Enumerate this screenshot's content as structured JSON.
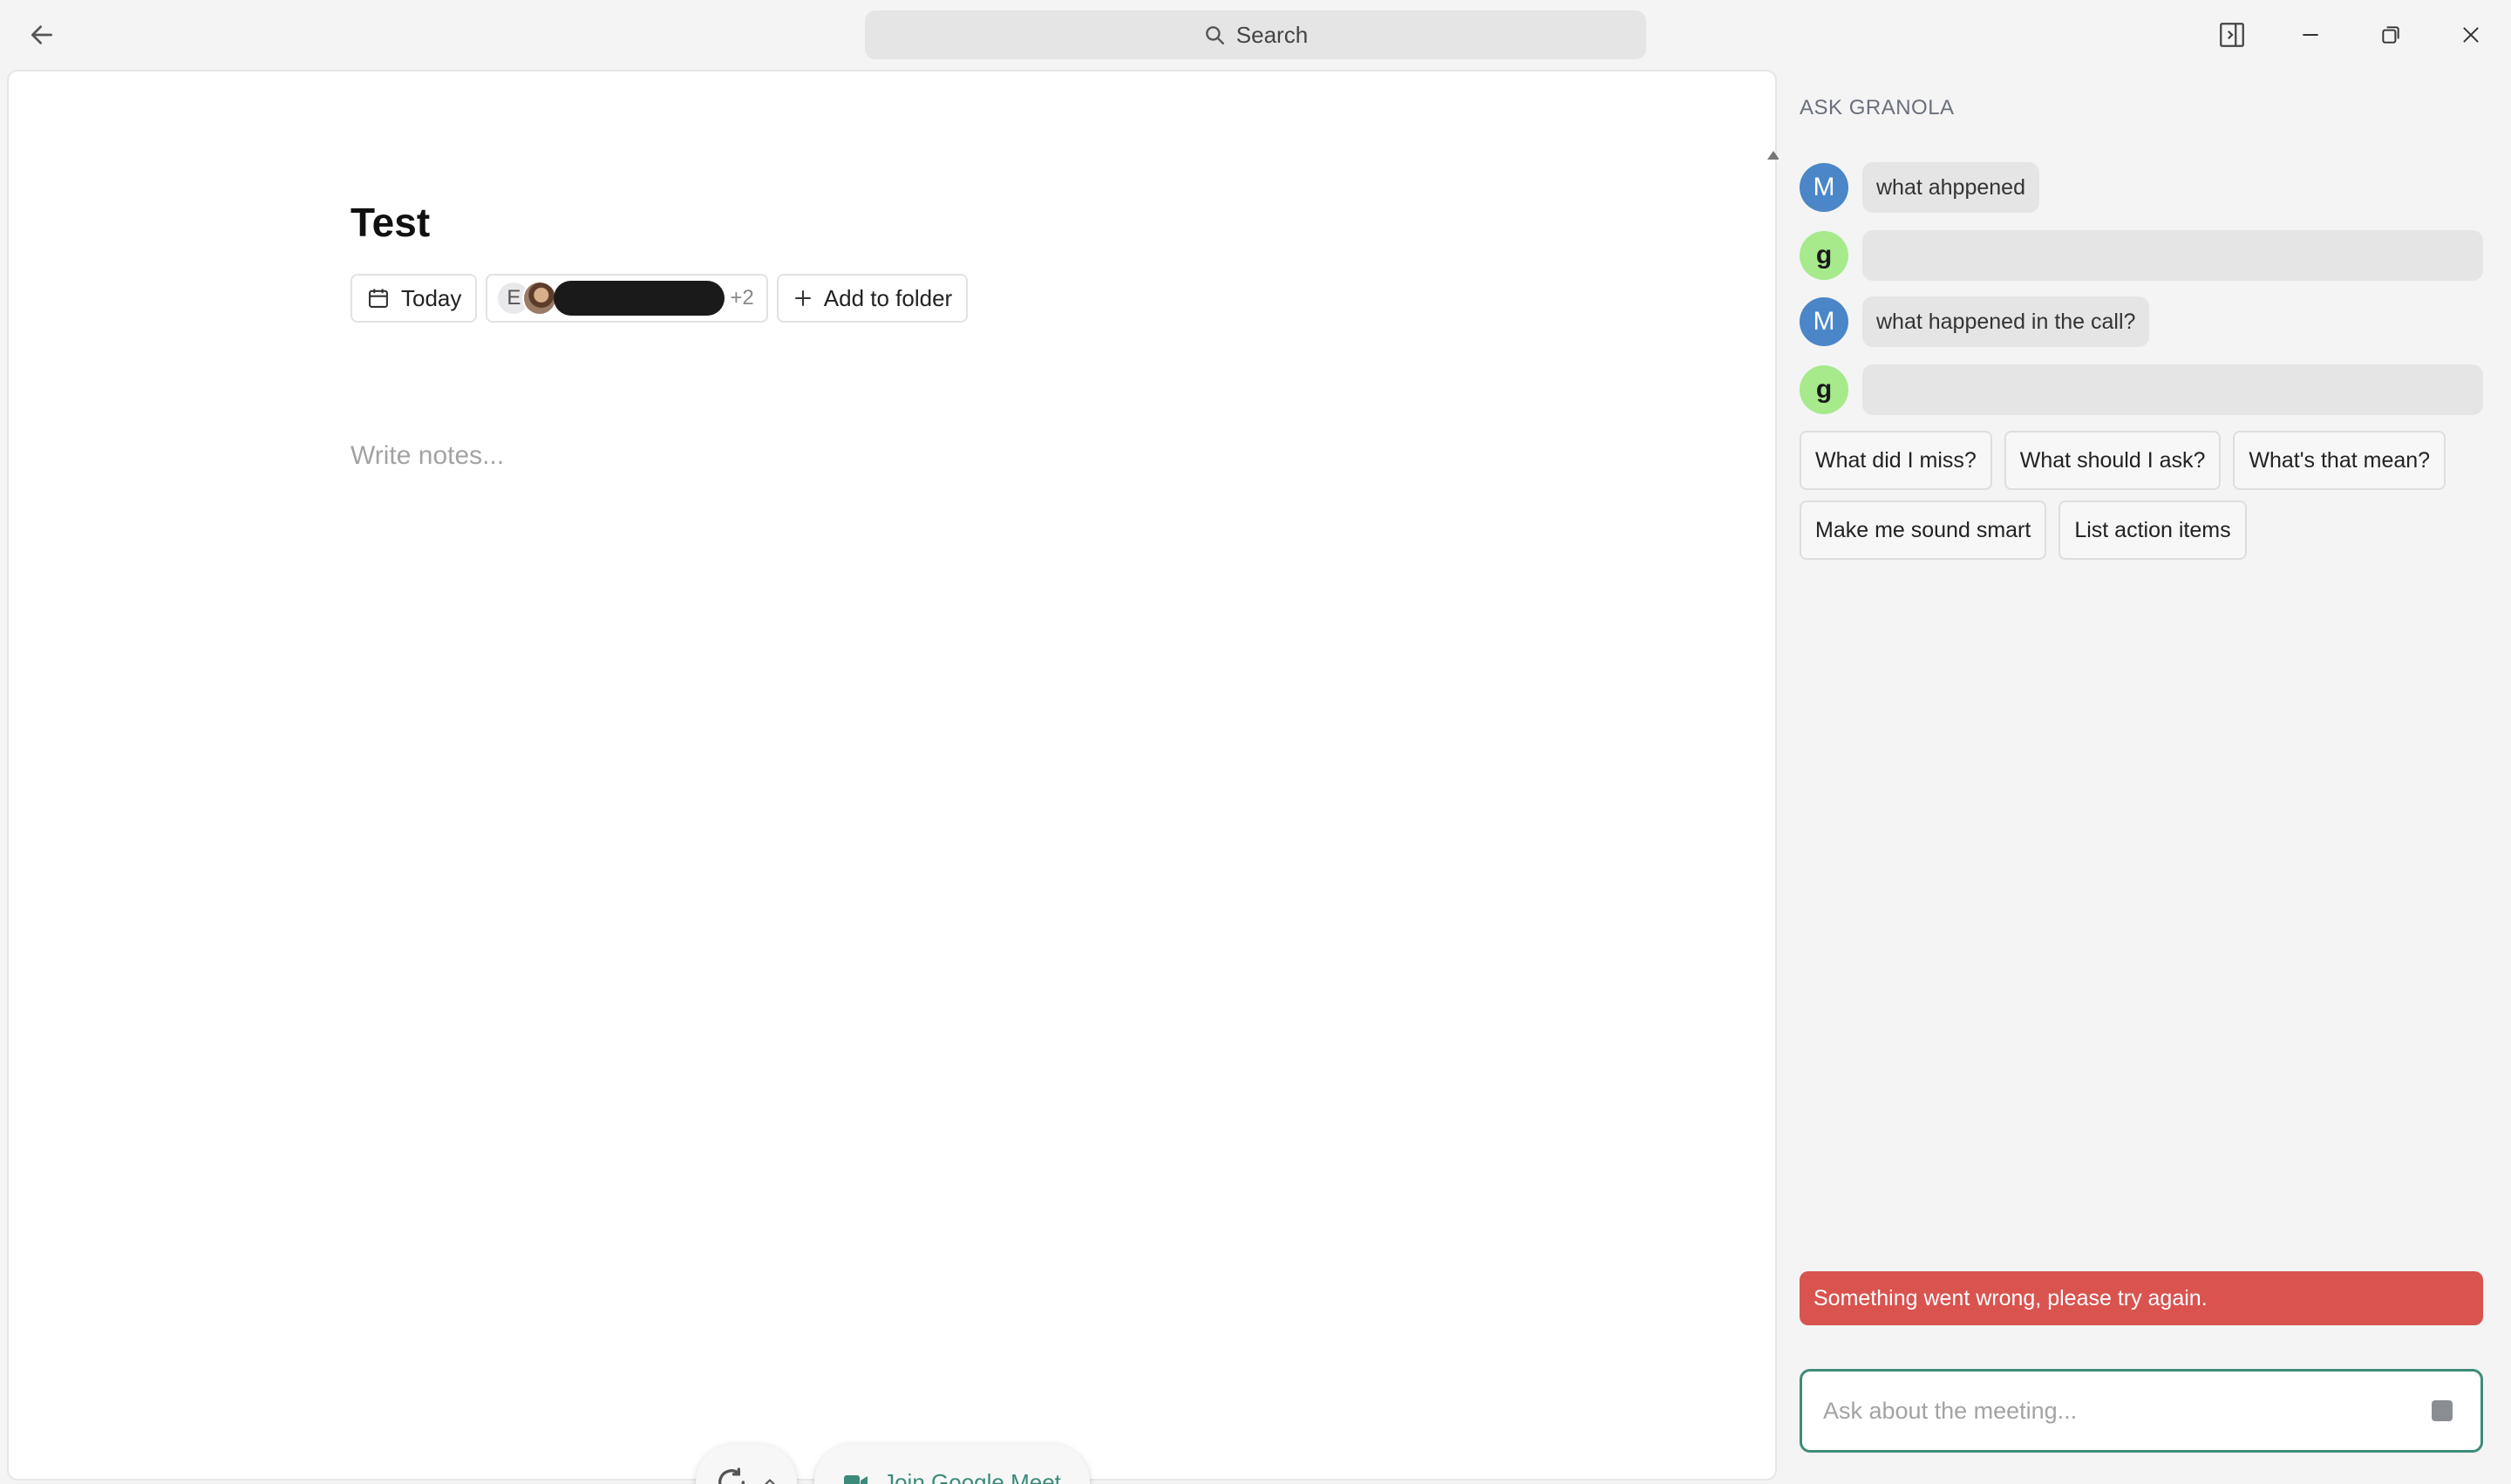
{
  "titlebar": {
    "search_label": "Search"
  },
  "note": {
    "title": "Test",
    "date_label": "Today",
    "attendee_initial": "E",
    "attendee_more": "+2",
    "add_folder_label": "Add to folder",
    "notes_placeholder": "Write notes..."
  },
  "controls": {
    "join_meet_label": "Join Google Meet"
  },
  "chat": {
    "title": "ASK GRANOLA",
    "user_initial": "M",
    "ai_initial": "g",
    "messages": [
      {
        "role": "user",
        "text": "what ahppened"
      },
      {
        "role": "assistant",
        "text": ""
      },
      {
        "role": "user",
        "text": "what happened in the call?"
      },
      {
        "role": "assistant",
        "text": ""
      }
    ],
    "suggestions_row1": [
      "What did I miss?",
      "What should I ask?",
      "What's that mean?"
    ],
    "suggestions_row2": [
      "Make me sound smart",
      "List action items"
    ],
    "error_text": "Something went wrong, please try again.",
    "input_placeholder": "Ask about the meeting..."
  },
  "colors": {
    "accent": "#3d8c79",
    "user_avatar": "#4a86c8",
    "ai_avatar": "#a6ea8c",
    "error": "#d9534f"
  }
}
